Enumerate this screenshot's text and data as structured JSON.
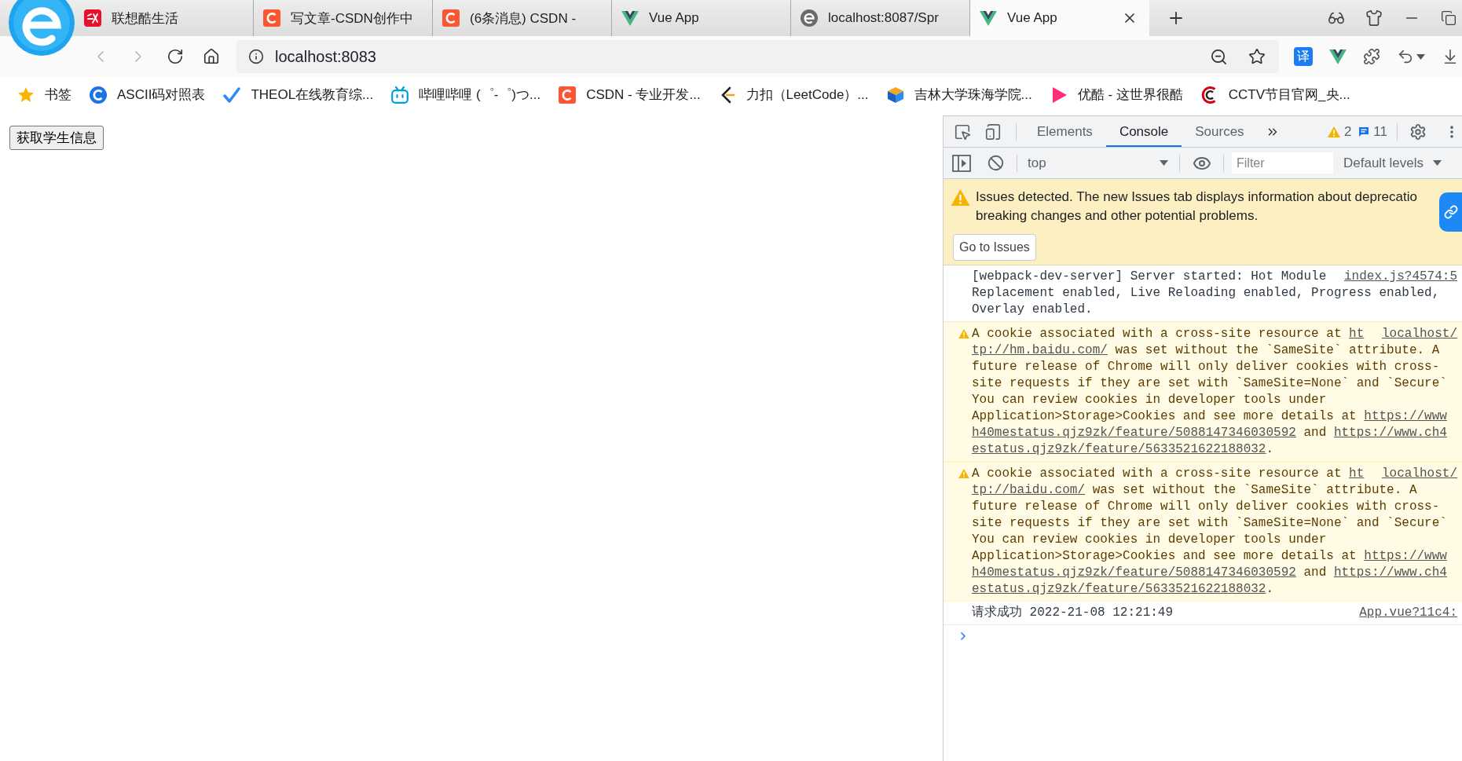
{
  "browser": {
    "tabs": [
      {
        "title": "联想酷生活",
        "kind": "tile",
        "selected": false
      },
      {
        "title": "写文章-CSDN创作中",
        "kind": "arc",
        "selected": false
      },
      {
        "title": "(6条消息) CSDN -",
        "kind": "arc",
        "selected": false
      },
      {
        "title": "Vue App",
        "kind": "chevron",
        "selected": false
      },
      {
        "title": "localhost:8087/Spr",
        "kind": "swirl",
        "selected": false
      },
      {
        "title": "Vue App",
        "kind": "chevron",
        "selected": true
      }
    ],
    "back_button": {
      "disabled": true
    },
    "forward_button": {
      "disabled": true
    },
    "address_bar": {
      "url": "localhost:8083"
    },
    "translate_button": {
      "label": "译"
    },
    "bookmarks": [
      {
        "label": "书签",
        "kind": "star"
      },
      {
        "label": "ASCII码对照表",
        "kind": "arcdisc"
      },
      {
        "label": "THEOL在线教育综...",
        "kind": "check"
      },
      {
        "label": "哔哩哔哩 (゜-゜)つ...",
        "kind": "tv"
      },
      {
        "label": "CSDN - 专业开发...",
        "kind": "arc"
      },
      {
        "label": "力扣（LeetCode）...",
        "kind": "angle"
      },
      {
        "label": "吉林大学珠海学院...",
        "kind": "cube"
      },
      {
        "label": "优酷 - 这世界很酷",
        "kind": "play"
      },
      {
        "label": "CCTV节目官网_央...",
        "kind": "rings"
      }
    ]
  },
  "page": {
    "button": "获取学生信息"
  },
  "devtools": {
    "tabs": [
      {
        "label": "Elements",
        "selected": false
      },
      {
        "label": "Console",
        "selected": true
      },
      {
        "label": "Sources",
        "selected": false
      }
    ],
    "warning_count": "2",
    "message_count": "11",
    "context": "top",
    "filter": {
      "placeholder": "Filter"
    },
    "levels": "Default levels",
    "issues_banner": {
      "lines": [
        "Issues detected. The new Issues tab displays information about deprecatio",
        "breaking changes and other potential problems."
      ],
      "button": "Go to Issues"
    },
    "console": {
      "messages": [
        {
          "kind": "info",
          "source": "index.js?4574:5",
          "lines": [
            [
              {
                "kind": "text",
                "text": "[webpack-dev-server] Server started: Hot Module"
              }
            ],
            [
              {
                "kind": "text",
                "text": "Replacement enabled, Live Reloading enabled, Progress enabled,"
              }
            ],
            [
              {
                "kind": "text",
                "text": "Overlay enabled."
              }
            ]
          ]
        },
        {
          "kind": "warning",
          "source": "localhost/",
          "lines": [
            [
              {
                "kind": "text",
                "text": "A cookie associated with a cross-site resource at "
              },
              {
                "kind": "link",
                "text": "ht"
              }
            ],
            [
              {
                "kind": "link",
                "text": "tp://hm.baidu.com/"
              },
              {
                "kind": "text",
                "text": " was set without the `SameSite` attribute. A"
              }
            ],
            [
              {
                "kind": "text",
                "text": "future release of Chrome will only deliver cookies with cross-"
              }
            ],
            [
              {
                "kind": "text",
                "text": "site requests if they are set with `SameSite=None` and `Secure`"
              }
            ],
            [
              {
                "kind": "text",
                "text": "You can review cookies in developer tools under"
              }
            ],
            [
              {
                "kind": "text",
                "text": "Application>Storage>Cookies and see more details at "
              },
              {
                "kind": "link",
                "text": "https://www"
              }
            ],
            [
              {
                "kind": "link",
                "text": "h40mestatus.qjz9zk/feature/5088147346030592"
              },
              {
                "kind": "text",
                "text": " and "
              },
              {
                "kind": "link",
                "text": "https://www.ch4"
              }
            ],
            [
              {
                "kind": "link",
                "text": "estatus.qjz9zk/feature/5633521622188032"
              },
              {
                "kind": "text",
                "text": "."
              }
            ]
          ]
        },
        {
          "kind": "warning",
          "source": "localhost/",
          "lines": [
            [
              {
                "kind": "text",
                "text": "A cookie associated with a cross-site resource at "
              },
              {
                "kind": "link",
                "text": "ht"
              }
            ],
            [
              {
                "kind": "link",
                "text": "tp://baidu.com/"
              },
              {
                "kind": "text",
                "text": " was set without the `SameSite` attribute. A"
              }
            ],
            [
              {
                "kind": "text",
                "text": "future release of Chrome will only deliver cookies with cross-"
              }
            ],
            [
              {
                "kind": "text",
                "text": "site requests if they are set with `SameSite=None` and `Secure`"
              }
            ],
            [
              {
                "kind": "text",
                "text": "You can review cookies in developer tools under"
              }
            ],
            [
              {
                "kind": "text",
                "text": "Application>Storage>Cookies and see more details at "
              },
              {
                "kind": "link",
                "text": "https://www"
              }
            ],
            [
              {
                "kind": "link",
                "text": "h40mestatus.qjz9zk/feature/5088147346030592"
              },
              {
                "kind": "text",
                "text": " and "
              },
              {
                "kind": "link",
                "text": "https://www.ch4"
              }
            ],
            [
              {
                "kind": "link",
                "text": "estatus.qjz9zk/feature/5633521622188032"
              },
              {
                "kind": "text",
                "text": "."
              }
            ]
          ]
        },
        {
          "kind": "log",
          "source": "App.vue?11c4:",
          "lines": [
            [
              {
                "kind": "text",
                "text": "请求成功 2022-21-08 12:21:49"
              }
            ]
          ]
        }
      ]
    }
  }
}
